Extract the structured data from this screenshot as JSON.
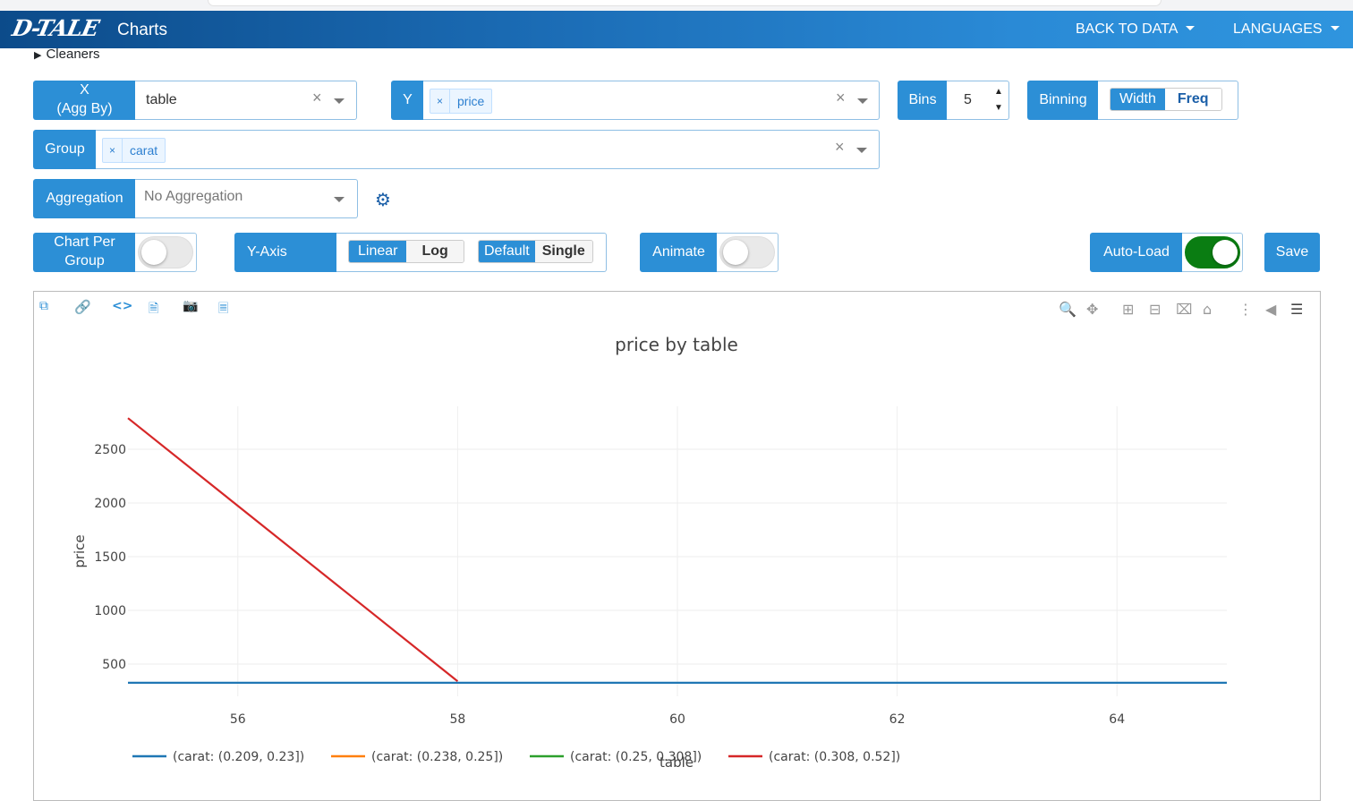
{
  "navbar": {
    "logo": "D-TALE",
    "title": "Charts",
    "back_to_data": "BACK TO DATA",
    "languages": "LANGUAGES"
  },
  "cleaners": {
    "label": "Cleaners"
  },
  "x_field": {
    "label_line1": "X",
    "label_line2": "(Agg By)",
    "value": "table"
  },
  "y_field": {
    "label": "Y",
    "tag": "price"
  },
  "bins": {
    "label": "Bins",
    "value": "5"
  },
  "binning": {
    "label": "Binning",
    "options": [
      "Width",
      "Freq"
    ],
    "selected": "Width"
  },
  "group_field": {
    "label": "Group",
    "tag": "carat"
  },
  "aggregation": {
    "label": "Aggregation",
    "placeholder": "No Aggregation"
  },
  "chart_per_group": {
    "label_line1": "Chart Per",
    "label_line2": "Group",
    "on": false
  },
  "y_axis": {
    "label": "Y-Axis",
    "scale_options": [
      "Linear",
      "Log"
    ],
    "scale_selected": "Linear",
    "mode_options": [
      "Default",
      "Single"
    ],
    "mode_selected": "Default"
  },
  "animate": {
    "label": "Animate",
    "on": false
  },
  "auto_load": {
    "label": "Auto-Load",
    "on": true
  },
  "save": {
    "label": "Save"
  },
  "colors": {
    "primary": "#2c8fd6",
    "toggle_on": "#0a7d12"
  },
  "chart_toolbar": [
    "popup-icon",
    "link-icon",
    "code-icon",
    "export-html-icon",
    "camera-icon",
    "csv-icon"
  ],
  "modebar": [
    "zoom-icon",
    "pan-icon",
    "zoom-in-icon",
    "zoom-out-icon",
    "autoscale-icon",
    "reset-axes-icon",
    "spike-lines-icon",
    "hover-closest-icon",
    "hover-compare-icon"
  ],
  "chart_data": {
    "type": "line",
    "title": "price by table",
    "xlabel": "table",
    "ylabel": "price",
    "xlim": [
      55,
      65
    ],
    "ylim": [
      200,
      2900
    ],
    "xticks": [
      "56",
      "58",
      "60",
      "62",
      "64"
    ],
    "yticks": [
      "500",
      "1000",
      "1500",
      "2000",
      "2500"
    ],
    "grid": true,
    "legend_position": "bottom",
    "series": [
      {
        "name": "(carat: (0.209, 0.23])",
        "color": "#1f77b4",
        "x": [
          55,
          65
        ],
        "y": [
          326,
          326
        ]
      },
      {
        "name": "(carat: (0.238, 0.25])",
        "color": "#ff7f0e",
        "x": [],
        "y": []
      },
      {
        "name": "(carat: (0.25, 0.308])",
        "color": "#2ca02c",
        "x": [],
        "y": []
      },
      {
        "name": "(carat: (0.308, 0.52])",
        "color": "#d62728",
        "x": [
          55,
          58
        ],
        "y": [
          2790,
          340
        ]
      }
    ]
  }
}
